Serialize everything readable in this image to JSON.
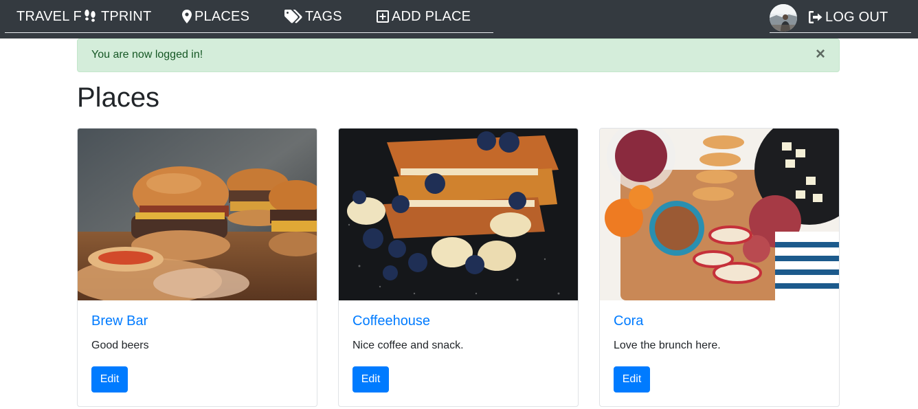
{
  "navbar": {
    "brand_prefix": "TRAVEL F",
    "brand_suffix": "TPRINT",
    "places_label": "PLACES",
    "tags_label": "TAGS",
    "add_place_label": "ADD PLACE",
    "logout_label": "LOG OUT",
    "icons": {
      "brand": "footprints-icon",
      "places": "map-marker-icon",
      "tags": "tags-icon",
      "add_place": "plus-square-icon",
      "logout": "sign-out-icon"
    }
  },
  "alert": {
    "message": "You are now logged in!",
    "close_label": "×"
  },
  "page": {
    "title": "Places"
  },
  "places": [
    {
      "name": "Brew Bar",
      "description": "Good beers",
      "edit_label": "Edit"
    },
    {
      "name": "Coffeehouse",
      "description": "Nice coffee and snack.",
      "edit_label": "Edit"
    },
    {
      "name": "Cora",
      "description": "Love the brunch here.",
      "edit_label": "Edit"
    }
  ],
  "colors": {
    "navbar_bg": "#343a40",
    "link": "#007bff",
    "button": "#007bff",
    "alert_bg": "#d4edda",
    "alert_text": "#155724"
  }
}
